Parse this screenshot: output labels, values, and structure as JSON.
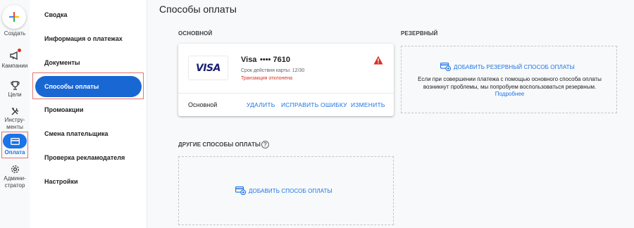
{
  "rail": {
    "create_label": "Создать",
    "items": [
      {
        "label": "Кампании",
        "icon": "megaphone-icon"
      },
      {
        "label": "Цели",
        "icon": "trophy-icon"
      },
      {
        "label": "Инстру-",
        "label2": "менты",
        "icon": "tools-icon"
      },
      {
        "label": "Оплата",
        "icon": "credit-card-icon"
      },
      {
        "label": "Админи-",
        "label2": "стратор",
        "icon": "gear-icon"
      }
    ]
  },
  "nav": {
    "items": [
      "Сводка",
      "Информация о платежах",
      "Документы",
      "Способы оплаты",
      "Промоакции",
      "Смена плательщика",
      "Проверка рекламодателя",
      "Настройки"
    ],
    "active_index": 3
  },
  "main": {
    "title": "Способы оплаты",
    "primary_label": "ОСНОВНОЙ",
    "backup_label": "РЕЗЕРВНЫЙ",
    "other_label": "ДРУГИЕ СПОСОБЫ ОПЛАТЫ",
    "help_glyph": "?"
  },
  "card": {
    "logo_text": "VISA",
    "brand": "Visa",
    "number": "•••• 7610",
    "expiry": "Срок действия карты: 12/30",
    "error": "Транзакция отклонена",
    "role": "Основной",
    "actions": [
      "УДАЛИТЬ",
      "ИСПРАВИТЬ ОШИБКУ",
      "ИЗМЕНИТЬ"
    ]
  },
  "backup": {
    "add_label": "ДОБАВИТЬ РЕЗЕРВНЫЙ СПОСОБ ОПЛАТЫ",
    "description": "Если при совершении платежа с помощью основного способа оплаты возникнут проблемы, мы попробуем воспользоваться резервным.",
    "more_link": "Подробнее"
  },
  "other": {
    "add_label": "ДОБАВИТЬ СПОСОБ ОПЛАТЫ"
  },
  "colors": {
    "accent": "#1a73e8",
    "active_nav": "#1967d2",
    "error": "#d93025",
    "visa": "#1a1f71"
  }
}
